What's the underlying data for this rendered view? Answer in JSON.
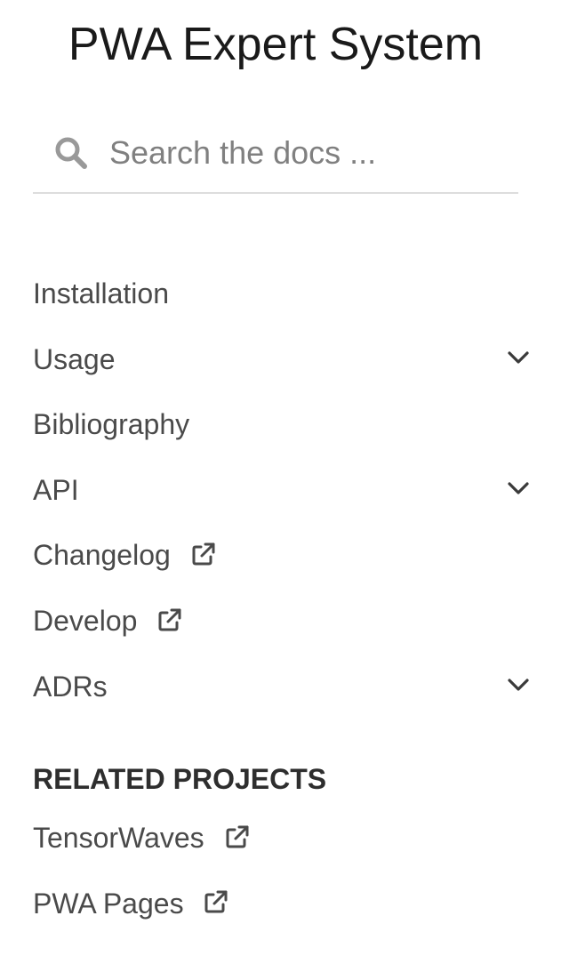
{
  "site": {
    "title": "PWA Expert System"
  },
  "search": {
    "placeholder": "Search the docs ..."
  },
  "nav": {
    "items": [
      {
        "label": "Installation",
        "external": false,
        "expandable": false
      },
      {
        "label": "Usage",
        "external": false,
        "expandable": true
      },
      {
        "label": "Bibliography",
        "external": false,
        "expandable": false
      },
      {
        "label": "API",
        "external": false,
        "expandable": true
      },
      {
        "label": "Changelog",
        "external": true,
        "expandable": false
      },
      {
        "label": "Develop",
        "external": true,
        "expandable": false
      },
      {
        "label": "ADRs",
        "external": false,
        "expandable": true
      }
    ]
  },
  "related": {
    "heading": "RELATED PROJECTS",
    "items": [
      {
        "label": "TensorWaves",
        "external": true
      },
      {
        "label": "PWA Pages",
        "external": true
      }
    ]
  },
  "icons": {
    "search": "search-icon",
    "external": "external-link-icon",
    "expand": "chevron-down-icon"
  },
  "colors": {
    "text": "#4a4a4a",
    "title": "#1a1a1a",
    "icon": "#999999",
    "divider": "#dddddd"
  }
}
